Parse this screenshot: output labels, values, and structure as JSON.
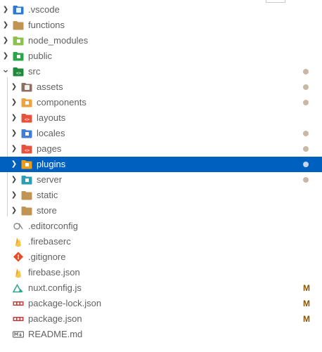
{
  "explorer": {
    "items": [
      {
        "label": ".vscode",
        "kind": "folder",
        "icon": "vscode-folder-icon",
        "color": "#2b79d2",
        "expanded": false,
        "depth": 0
      },
      {
        "label": "functions",
        "kind": "folder",
        "icon": "folder-icon",
        "color": "#c09553",
        "expanded": false,
        "depth": 0
      },
      {
        "label": "node_modules",
        "kind": "folder",
        "icon": "node-folder-icon",
        "color": "#8bc34a",
        "expanded": false,
        "depth": 0
      },
      {
        "label": "public",
        "kind": "folder",
        "icon": "public-folder-icon",
        "color": "#28a745",
        "expanded": false,
        "depth": 0
      },
      {
        "label": "src",
        "kind": "folder",
        "icon": "src-folder-icon",
        "color": "#1f8a3a",
        "expanded": true,
        "depth": 0,
        "badge": "dot"
      },
      {
        "label": "assets",
        "kind": "folder",
        "icon": "assets-folder-icon",
        "color": "#8d6e63",
        "expanded": false,
        "depth": 1,
        "badge": "dot"
      },
      {
        "label": "components",
        "kind": "folder",
        "icon": "components-folder-icon",
        "color": "#f1a23b",
        "expanded": false,
        "depth": 1,
        "badge": "dot"
      },
      {
        "label": "layouts",
        "kind": "folder",
        "icon": "layouts-folder-icon",
        "color": "#e5533d",
        "expanded": false,
        "depth": 1
      },
      {
        "label": "locales",
        "kind": "folder",
        "icon": "locales-folder-icon",
        "color": "#3f7dd6",
        "expanded": false,
        "depth": 1,
        "badge": "dot"
      },
      {
        "label": "pages",
        "kind": "folder",
        "icon": "pages-folder-icon",
        "color": "#e5533d",
        "expanded": false,
        "depth": 1,
        "badge": "dot"
      },
      {
        "label": "plugins",
        "kind": "folder",
        "icon": "plugins-folder-icon",
        "color": "#f39c12",
        "expanded": false,
        "depth": 1,
        "badge": "dot",
        "selected": true
      },
      {
        "label": "server",
        "kind": "folder",
        "icon": "server-folder-icon",
        "color": "#2a9fb8",
        "expanded": false,
        "depth": 1,
        "badge": "dot"
      },
      {
        "label": "static",
        "kind": "folder",
        "icon": "folder-icon",
        "color": "#c09553",
        "expanded": false,
        "depth": 1
      },
      {
        "label": "store",
        "kind": "folder",
        "icon": "folder-icon",
        "color": "#c09553",
        "expanded": false,
        "depth": 1
      },
      {
        "label": ".editorconfig",
        "kind": "file",
        "icon": "editorconfig-icon",
        "color": "#8a8a8a",
        "depth": 0
      },
      {
        "label": ".firebaserc",
        "kind": "file",
        "icon": "firebase-icon",
        "color": "#f5a623",
        "depth": 0
      },
      {
        "label": ".gitignore",
        "kind": "file",
        "icon": "git-icon",
        "color": "#e44d26",
        "depth": 0
      },
      {
        "label": "firebase.json",
        "kind": "file",
        "icon": "firebase-icon",
        "color": "#f5a623",
        "depth": 0
      },
      {
        "label": "nuxt.config.js",
        "kind": "file",
        "icon": "nuxt-icon",
        "color": "#2ca58d",
        "depth": 0,
        "badge": "M"
      },
      {
        "label": "package-lock.json",
        "kind": "file",
        "icon": "npm-icon",
        "color": "#cb3837",
        "depth": 0,
        "badge": "M"
      },
      {
        "label": "package.json",
        "kind": "file",
        "icon": "npm-icon",
        "color": "#cb3837",
        "depth": 0,
        "badge": "M"
      },
      {
        "label": "README.md",
        "kind": "file",
        "icon": "markdown-icon",
        "color": "#6b6b6b",
        "depth": 0
      }
    ]
  }
}
